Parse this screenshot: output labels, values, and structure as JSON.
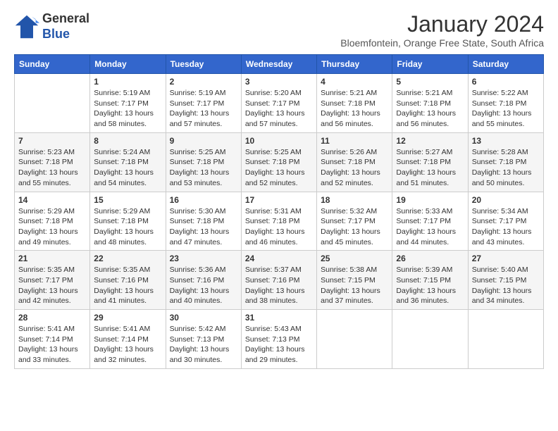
{
  "logo": {
    "general": "General",
    "blue": "Blue"
  },
  "header": {
    "month_title": "January 2024",
    "subtitle": "Bloemfontein, Orange Free State, South Africa"
  },
  "weekdays": [
    "Sunday",
    "Monday",
    "Tuesday",
    "Wednesday",
    "Thursday",
    "Friday",
    "Saturday"
  ],
  "weeks": [
    [
      {
        "day": "",
        "info": ""
      },
      {
        "day": "1",
        "info": "Sunrise: 5:19 AM\nSunset: 7:17 PM\nDaylight: 13 hours\nand 58 minutes."
      },
      {
        "day": "2",
        "info": "Sunrise: 5:19 AM\nSunset: 7:17 PM\nDaylight: 13 hours\nand 57 minutes."
      },
      {
        "day": "3",
        "info": "Sunrise: 5:20 AM\nSunset: 7:17 PM\nDaylight: 13 hours\nand 57 minutes."
      },
      {
        "day": "4",
        "info": "Sunrise: 5:21 AM\nSunset: 7:18 PM\nDaylight: 13 hours\nand 56 minutes."
      },
      {
        "day": "5",
        "info": "Sunrise: 5:21 AM\nSunset: 7:18 PM\nDaylight: 13 hours\nand 56 minutes."
      },
      {
        "day": "6",
        "info": "Sunrise: 5:22 AM\nSunset: 7:18 PM\nDaylight: 13 hours\nand 55 minutes."
      }
    ],
    [
      {
        "day": "7",
        "info": "Sunrise: 5:23 AM\nSunset: 7:18 PM\nDaylight: 13 hours\nand 55 minutes."
      },
      {
        "day": "8",
        "info": "Sunrise: 5:24 AM\nSunset: 7:18 PM\nDaylight: 13 hours\nand 54 minutes."
      },
      {
        "day": "9",
        "info": "Sunrise: 5:25 AM\nSunset: 7:18 PM\nDaylight: 13 hours\nand 53 minutes."
      },
      {
        "day": "10",
        "info": "Sunrise: 5:25 AM\nSunset: 7:18 PM\nDaylight: 13 hours\nand 52 minutes."
      },
      {
        "day": "11",
        "info": "Sunrise: 5:26 AM\nSunset: 7:18 PM\nDaylight: 13 hours\nand 52 minutes."
      },
      {
        "day": "12",
        "info": "Sunrise: 5:27 AM\nSunset: 7:18 PM\nDaylight: 13 hours\nand 51 minutes."
      },
      {
        "day": "13",
        "info": "Sunrise: 5:28 AM\nSunset: 7:18 PM\nDaylight: 13 hours\nand 50 minutes."
      }
    ],
    [
      {
        "day": "14",
        "info": "Sunrise: 5:29 AM\nSunset: 7:18 PM\nDaylight: 13 hours\nand 49 minutes."
      },
      {
        "day": "15",
        "info": "Sunrise: 5:29 AM\nSunset: 7:18 PM\nDaylight: 13 hours\nand 48 minutes."
      },
      {
        "day": "16",
        "info": "Sunrise: 5:30 AM\nSunset: 7:18 PM\nDaylight: 13 hours\nand 47 minutes."
      },
      {
        "day": "17",
        "info": "Sunrise: 5:31 AM\nSunset: 7:18 PM\nDaylight: 13 hours\nand 46 minutes."
      },
      {
        "day": "18",
        "info": "Sunrise: 5:32 AM\nSunset: 7:17 PM\nDaylight: 13 hours\nand 45 minutes."
      },
      {
        "day": "19",
        "info": "Sunrise: 5:33 AM\nSunset: 7:17 PM\nDaylight: 13 hours\nand 44 minutes."
      },
      {
        "day": "20",
        "info": "Sunrise: 5:34 AM\nSunset: 7:17 PM\nDaylight: 13 hours\nand 43 minutes."
      }
    ],
    [
      {
        "day": "21",
        "info": "Sunrise: 5:35 AM\nSunset: 7:17 PM\nDaylight: 13 hours\nand 42 minutes."
      },
      {
        "day": "22",
        "info": "Sunrise: 5:35 AM\nSunset: 7:16 PM\nDaylight: 13 hours\nand 41 minutes."
      },
      {
        "day": "23",
        "info": "Sunrise: 5:36 AM\nSunset: 7:16 PM\nDaylight: 13 hours\nand 40 minutes."
      },
      {
        "day": "24",
        "info": "Sunrise: 5:37 AM\nSunset: 7:16 PM\nDaylight: 13 hours\nand 38 minutes."
      },
      {
        "day": "25",
        "info": "Sunrise: 5:38 AM\nSunset: 7:15 PM\nDaylight: 13 hours\nand 37 minutes."
      },
      {
        "day": "26",
        "info": "Sunrise: 5:39 AM\nSunset: 7:15 PM\nDaylight: 13 hours\nand 36 minutes."
      },
      {
        "day": "27",
        "info": "Sunrise: 5:40 AM\nSunset: 7:15 PM\nDaylight: 13 hours\nand 34 minutes."
      }
    ],
    [
      {
        "day": "28",
        "info": "Sunrise: 5:41 AM\nSunset: 7:14 PM\nDaylight: 13 hours\nand 33 minutes."
      },
      {
        "day": "29",
        "info": "Sunrise: 5:41 AM\nSunset: 7:14 PM\nDaylight: 13 hours\nand 32 minutes."
      },
      {
        "day": "30",
        "info": "Sunrise: 5:42 AM\nSunset: 7:13 PM\nDaylight: 13 hours\nand 30 minutes."
      },
      {
        "day": "31",
        "info": "Sunrise: 5:43 AM\nSunset: 7:13 PM\nDaylight: 13 hours\nand 29 minutes."
      },
      {
        "day": "",
        "info": ""
      },
      {
        "day": "",
        "info": ""
      },
      {
        "day": "",
        "info": ""
      }
    ]
  ]
}
